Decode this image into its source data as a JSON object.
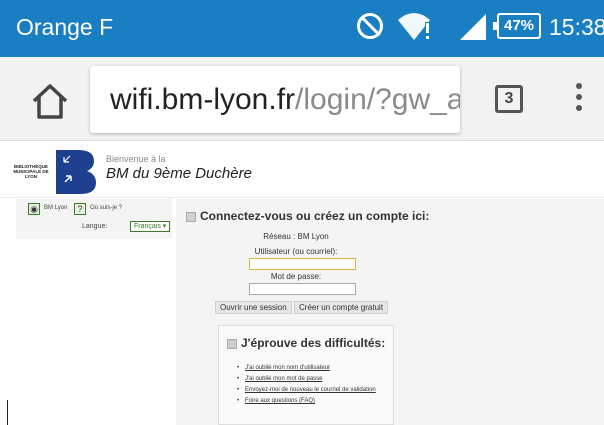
{
  "status_bar": {
    "carrier": "Orange F",
    "battery": "47%",
    "time": "15:38",
    "icons": [
      "do-not-disturb-icon",
      "wifi-alert-icon",
      "signal-icon",
      "battery-icon"
    ]
  },
  "browser": {
    "url_host": "wifi.bm-lyon.fr",
    "url_path": "/login/?gw_ac",
    "tab_count": "3",
    "icons": [
      "home-icon",
      "tabs-icon",
      "overflow-menu-icon"
    ]
  },
  "site": {
    "library_name": "BIBLIOTHÈQUE MUNICIPALE DE LYON",
    "welcome": "Bienvenue à la",
    "name": "BM du 9ème Duchère"
  },
  "sidebar": {
    "btn1_label": "BM Lyon",
    "btn2_label": "Où suis-je ?",
    "btn2_glyph": "?",
    "language_label": "Langue:",
    "language_value": "Français ▾"
  },
  "login": {
    "heading": "Connectez-vous ou créez un compte ici:",
    "network": "Réseau : BM Lyon",
    "username_label": "Utilisateur (ou courriel):",
    "username_value": "",
    "password_label": "Mot de passe:",
    "password_value": "",
    "open_session": "Ouvrir une session",
    "create_account": "Créer un compte gratuit"
  },
  "help": {
    "heading": "J'éprouve des difficultés:",
    "items": [
      "J'ai oublié mon nom d'utilisateur",
      "J'ai oublié mon mot de passe",
      "Envoyez-moi de nouveau le courriel de validation",
      "Foire aux questions (FAQ)"
    ]
  },
  "colors": {
    "status_bar": "#1a7fc2",
    "logo_blue": "#1f3f8f",
    "accent_green": "#3a7a2a"
  }
}
